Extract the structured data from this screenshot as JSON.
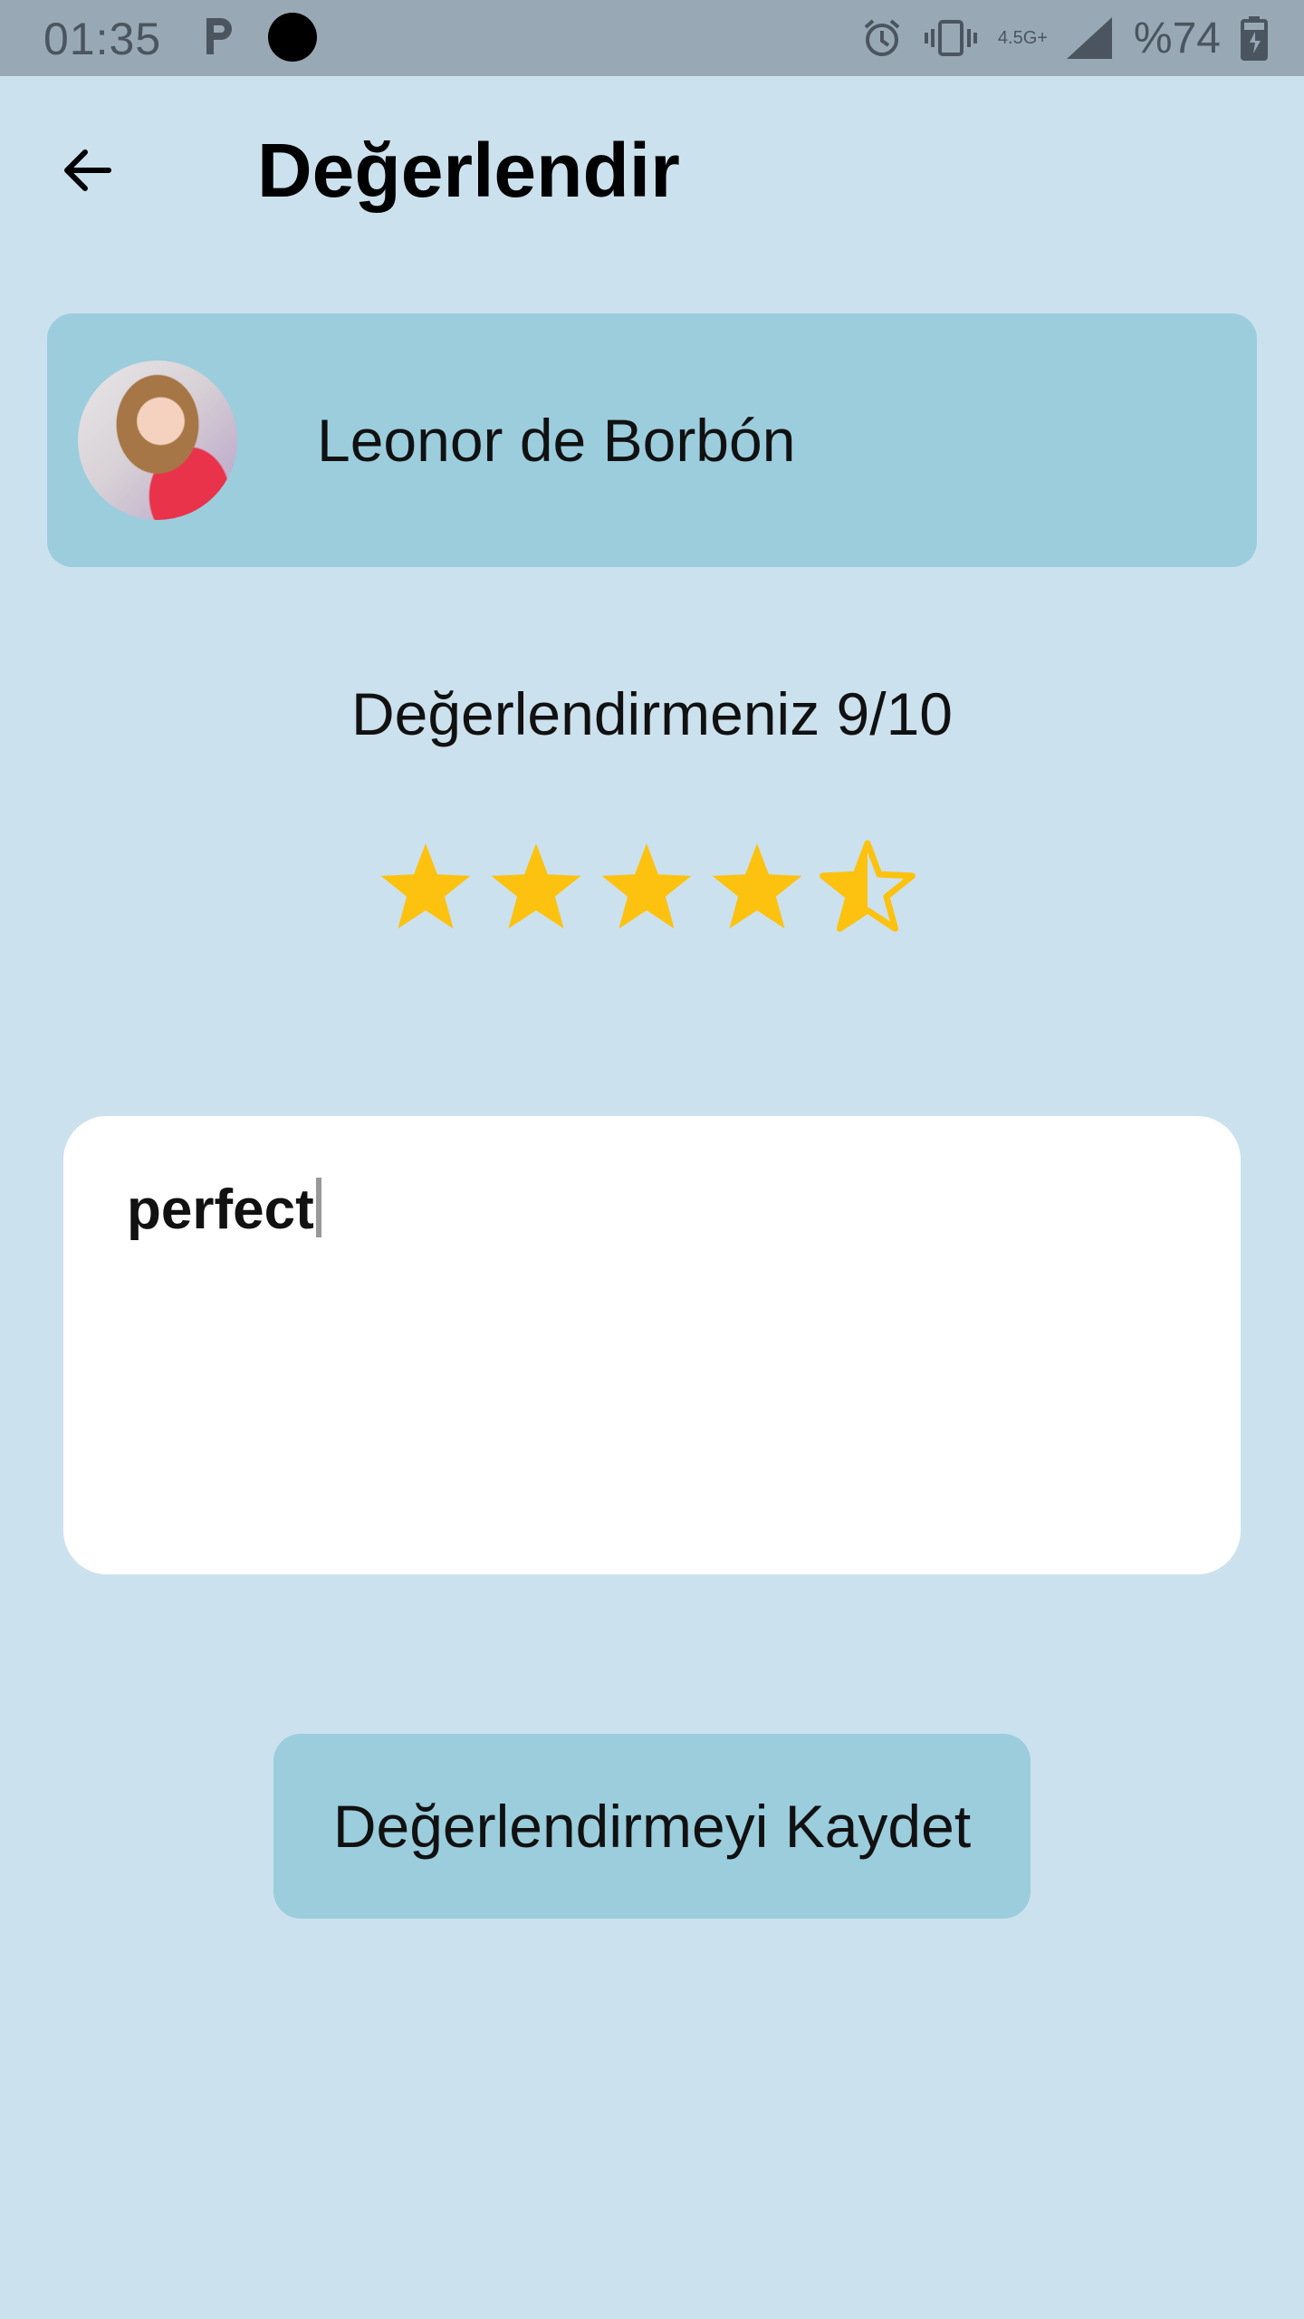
{
  "status_bar": {
    "time": "01:35",
    "network": "4.5G+",
    "battery": "%74",
    "icons": [
      "parking-icon",
      "camera-dot-icon",
      "alarm-icon",
      "vibrate-icon",
      "signal-icon",
      "battery-icon"
    ]
  },
  "header": {
    "title": "Değerlendir",
    "back_icon": "arrow-left-icon"
  },
  "person": {
    "name": "Leonor de Borbón"
  },
  "rating": {
    "label": "Değerlendirmeniz 9/10",
    "score": 9,
    "max": 10,
    "stars_filled": 4.5,
    "stars_total": 5,
    "star_color": "#fcc20f"
  },
  "comment": {
    "value": "perfect"
  },
  "actions": {
    "save_label": "Değerlendirmeyi Kaydet"
  },
  "colors": {
    "background": "#cce1ee",
    "card": "#9bcddd",
    "status_bar": "#98a9b5"
  }
}
